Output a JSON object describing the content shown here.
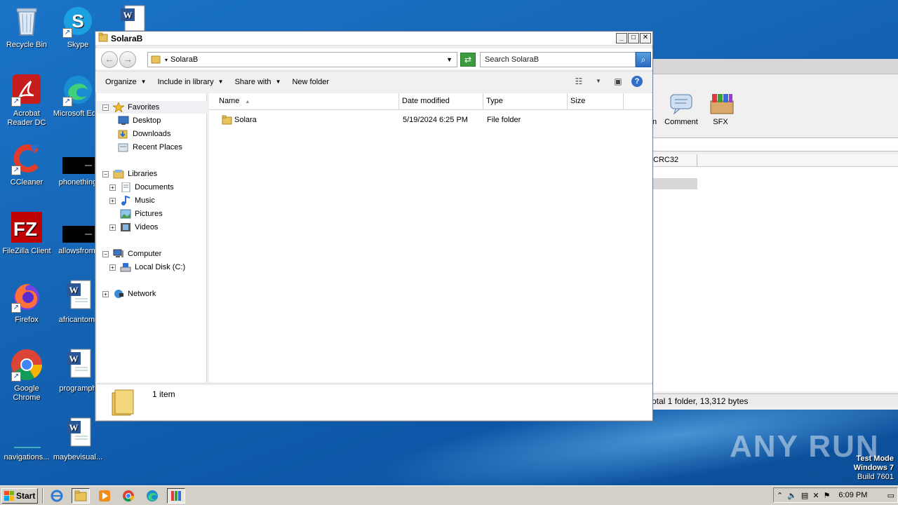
{
  "desktop": {
    "icons": [
      {
        "label": "Recycle Bin",
        "icon": "recycle-bin-icon"
      },
      {
        "label": "Skype",
        "icon": "skype-icon"
      },
      {
        "label": "Acrobat Reader DC",
        "icon": "acrobat-icon"
      },
      {
        "label": "Microsoft Ed...",
        "icon": "edge-icon"
      },
      {
        "label": "CCleaner",
        "icon": "ccleaner-icon"
      },
      {
        "label": "phonething",
        "icon": "file-icon"
      },
      {
        "label": "FileZilla Client",
        "icon": "filezilla-icon"
      },
      {
        "label": "allowsfrom.",
        "icon": "file-icon"
      },
      {
        "label": "Firefox",
        "icon": "firefox-icon"
      },
      {
        "label": "africantom.",
        "icon": "word-doc-icon"
      },
      {
        "label": "Google Chrome",
        "icon": "chrome-icon"
      },
      {
        "label": "programph",
        "icon": "word-doc-icon"
      },
      {
        "label": "navigations...",
        "icon": "file-icon"
      },
      {
        "label": "maybevisual...",
        "icon": "word-doc-icon"
      }
    ]
  },
  "bg_window": {
    "tools": [
      {
        "label": "n"
      },
      {
        "label": "Comment"
      },
      {
        "label": "SFX"
      }
    ],
    "column": "CRC32",
    "status": "otal 1 folder, 13,312 bytes"
  },
  "explorer": {
    "title": "SolaraB",
    "address": "SolaraB",
    "search_placeholder": "Search SolaraB",
    "commands": {
      "organize": "Organize",
      "include": "Include in library",
      "share": "Share with",
      "new_folder": "New folder"
    },
    "nav": {
      "favorites": "Favorites",
      "desktop": "Desktop",
      "downloads": "Downloads",
      "recent": "Recent Places",
      "libraries": "Libraries",
      "documents": "Documents",
      "music": "Music",
      "pictures": "Pictures",
      "videos": "Videos",
      "computer": "Computer",
      "local_disk": "Local Disk (C:)",
      "network": "Network"
    },
    "columns": {
      "name": "Name",
      "date": "Date modified",
      "type": "Type",
      "size": "Size"
    },
    "files": [
      {
        "name": "Solara",
        "date": "5/19/2024 6:25 PM",
        "type": "File folder",
        "size": ""
      }
    ],
    "details": "1 item"
  },
  "watermark": "ANY RUN",
  "test_mode": {
    "line1": "Test Mode",
    "line2": "Windows 7",
    "line3": "Build 7601"
  },
  "taskbar": {
    "start": "Start",
    "clock": "6:09 PM"
  }
}
